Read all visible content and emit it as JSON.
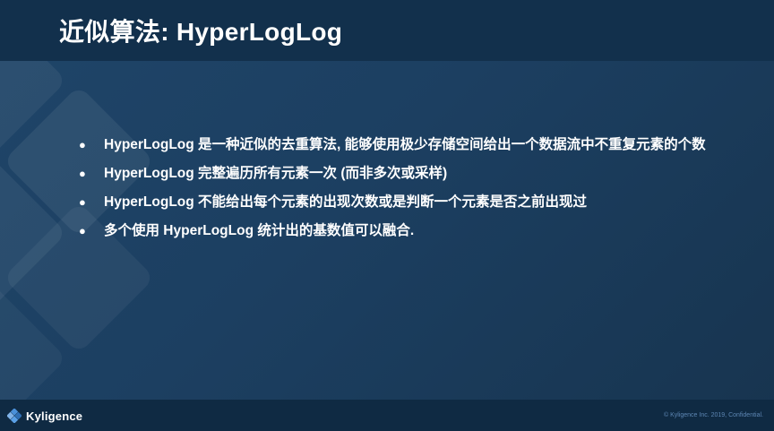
{
  "slide": {
    "title": "近似算法: HyperLogLog",
    "bullets": [
      "HyperLogLog 是一种近似的去重算法, 能够使用极少存储空间给出一个数据流中不重复元素的个数",
      "HyperLogLog 完整遍历所有元素一次 (而非多次或采样)",
      "HyperLogLog 不能给出每个元素的出现次数或是判断一个元素是否之前出现过",
      "多个使用 HyperLogLog 统计出的基数值可以融合."
    ],
    "bullet_glyph": "●"
  },
  "footer": {
    "logo_text": "Kyligence",
    "logo_icon": "kyligence-logo-icon",
    "copyright": "© Kyligence Inc. 2019, Confidential."
  },
  "colors": {
    "background": "#1e4466",
    "header_band": "#12304c",
    "footer_band": "#0f2a43",
    "text": "#ffffff",
    "logo_accent": "#4a90d9",
    "copyright_text": "#5d86b3"
  }
}
